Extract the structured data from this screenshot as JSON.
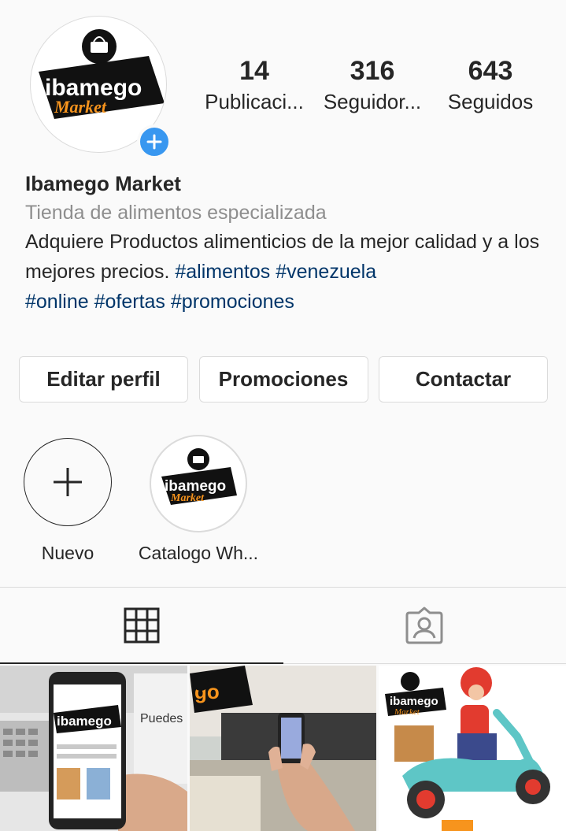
{
  "profile": {
    "name": "Ibamego Market",
    "category": "Tienda de alimentos especializada",
    "bio_text": "Adquiere Productos alimenticios de la mejor calidad y a los mejores precios. ",
    "hashtags": [
      "#alimentos",
      "#venezuela",
      "#online",
      "#ofertas",
      "#promociones"
    ],
    "logo_word_top": "ibamego",
    "logo_word_bottom": "Market"
  },
  "stats": [
    {
      "value": "14",
      "label": "Publicaci..."
    },
    {
      "value": "316",
      "label": "Seguidor..."
    },
    {
      "value": "643",
      "label": "Seguidos"
    }
  ],
  "actions": {
    "edit": "Editar perfil",
    "promos": "Promociones",
    "contact": "Contactar"
  },
  "highlights": [
    {
      "label": "Nuevo"
    },
    {
      "label": "Catalogo Wh..."
    }
  ],
  "tabs": [
    {
      "icon": "grid-icon",
      "active": true
    },
    {
      "icon": "tagged-icon",
      "active": false
    }
  ],
  "posts": [
    {
      "text": "Puedes PEDIR mismo"
    },
    {
      "text": ""
    },
    {
      "text": ""
    }
  ],
  "colors": {
    "accent_blue": "#3897f0",
    "hashtag": "#003569",
    "brand_orange": "#f7941d",
    "brand_black": "#111111"
  }
}
